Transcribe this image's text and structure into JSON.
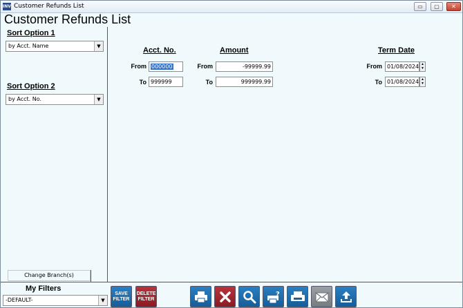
{
  "window": {
    "title": "Customer Refunds List",
    "app_icon": "INV"
  },
  "window_controls": {
    "minimize": "▭",
    "maximize": "▢",
    "close": "✕"
  },
  "page_title": "Customer Refunds List",
  "sidebar": {
    "sort1": {
      "label": "Sort Option 1",
      "value": "by Acct. Name"
    },
    "sort2": {
      "label": "Sort Option 2",
      "value": "by Acct. No."
    },
    "change_branch": "Change Branch(s)"
  },
  "filters": {
    "acct": {
      "header": "Acct. No.",
      "from_label": "From",
      "to_label": "To",
      "from": "000000",
      "to": "999999"
    },
    "amount": {
      "header": "Amount",
      "from_label": "From",
      "to_label": "To",
      "from": "-99999.99",
      "to": "999999.99"
    },
    "term_date": {
      "header": "Term Date",
      "from_label": "From",
      "to_label": "To",
      "from": "01/08/2024",
      "to": "01/08/2024"
    }
  },
  "bottom": {
    "my_filters_label": "My Filters",
    "my_filters_value": "-DEFAULT-",
    "save_filter": "SAVE FILTER",
    "delete_filter": "DELETE FILTER",
    "toolbar_icons": [
      "printer-icon",
      "cancel-x-icon",
      "search-magnifier-icon",
      "print-help-icon",
      "fax-printer-icon",
      "email-envelope-icon",
      "upload-export-icon"
    ]
  },
  "colors": {
    "panel_bg": "#f0fafd",
    "button_blue": "#1f6fb0",
    "button_red": "#9e222a",
    "button_gray": "#8a9096",
    "selection": "#3470c8"
  }
}
